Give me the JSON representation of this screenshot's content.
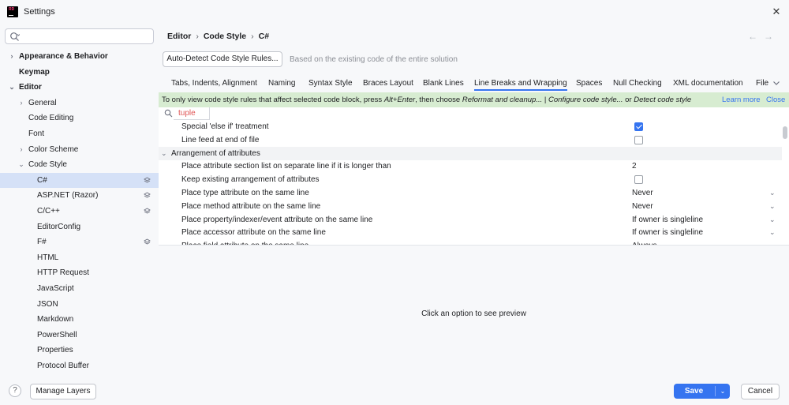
{
  "window": {
    "title": "Settings",
    "close": "✕",
    "logo_text_top": "RD"
  },
  "sidebar": {
    "search_placeholder": "",
    "items": [
      {
        "label": "Appearance & Behavior",
        "bold": true,
        "chevron": "›"
      },
      {
        "label": "Keymap",
        "bold": true
      },
      {
        "label": "Editor",
        "bold": true,
        "chevron": "⌄"
      },
      {
        "label": "General",
        "chevron": "›"
      },
      {
        "label": "Code Editing"
      },
      {
        "label": "Font"
      },
      {
        "label": "Color Scheme",
        "chevron": "›"
      },
      {
        "label": "Code Style",
        "chevron": "⌄"
      },
      {
        "label": "C#",
        "selected": true,
        "layer_icon": true
      },
      {
        "label": "ASP.NET (Razor)",
        "layer_icon": true
      },
      {
        "label": "C/C++",
        "layer_icon": true
      },
      {
        "label": "EditorConfig"
      },
      {
        "label": "F#",
        "layer_icon": true
      },
      {
        "label": "HTML"
      },
      {
        "label": "HTTP Request"
      },
      {
        "label": "JavaScript"
      },
      {
        "label": "JSON"
      },
      {
        "label": "Markdown"
      },
      {
        "label": "PowerShell"
      },
      {
        "label": "Properties"
      },
      {
        "label": "Protocol Buffer"
      }
    ]
  },
  "breadcrumb": {
    "part1": "Editor",
    "part2": "Code Style",
    "part3": "C#",
    "separator": "›",
    "nav_back": "←",
    "nav_forward": "→"
  },
  "autodetect": {
    "button": "Auto-Detect Code Style Rules...",
    "hint": "Based on the existing code of the entire solution"
  },
  "tabs": [
    {
      "label": "Tabs, Indents, Alignment"
    },
    {
      "label": "Naming"
    },
    {
      "label": "Syntax Style"
    },
    {
      "label": "Braces Layout"
    },
    {
      "label": "Blank Lines"
    },
    {
      "label": "Line Breaks and Wrapping",
      "active": true
    },
    {
      "label": "Spaces"
    },
    {
      "label": "Null Checking"
    },
    {
      "label": "XML documentation"
    },
    {
      "label": "File"
    }
  ],
  "banner": {
    "prefix": "To only view code style rules that affect selected code block, press ",
    "shortcut": "Alt+Enter",
    "middle": ", then choose ",
    "action1": "Reformat and cleanup...",
    "sep": " | ",
    "action2": "Configure code style...",
    "or": " or ",
    "action3": "Detect code style",
    "learn_more": "Learn more",
    "close": "Close"
  },
  "filter": {
    "value": "tuple"
  },
  "options": [
    {
      "label": "Special 'else if' treatment",
      "type": "checkbox",
      "checked": true
    },
    {
      "label": "Line feed at end of file",
      "type": "checkbox",
      "checked": false
    },
    {
      "label": "Arrangement of attributes",
      "type": "group",
      "chevron": "⌄"
    },
    {
      "label": "Place attribute section list on separate line if it is longer than",
      "type": "number",
      "value": "2"
    },
    {
      "label": "Keep existing arrangement of attributes",
      "type": "checkbox",
      "checked": false
    },
    {
      "label": "Place type attribute on the same line",
      "type": "select",
      "value": "Never"
    },
    {
      "label": "Place method attribute on the same line",
      "type": "select",
      "value": "Never"
    },
    {
      "label": "Place property/indexer/event attribute on the same line",
      "type": "select",
      "value": "If owner is singleline"
    },
    {
      "label": "Place accessor attribute on the same line",
      "type": "select",
      "value": "If owner is singleline"
    },
    {
      "label": "Place field attribute on the same line",
      "type": "select",
      "value": "Always"
    }
  ],
  "preview": {
    "text": "Click an option to see preview"
  },
  "footer": {
    "help": "?",
    "manage_layers": "Manage Layers",
    "save": "Save",
    "save_dropdown": "⌄",
    "cancel": "Cancel"
  },
  "colors": {
    "accent": "#3574f0",
    "banner_bg": "#d7ecd1",
    "selection": "#d5e1f7",
    "filter_text": "#e05555"
  }
}
